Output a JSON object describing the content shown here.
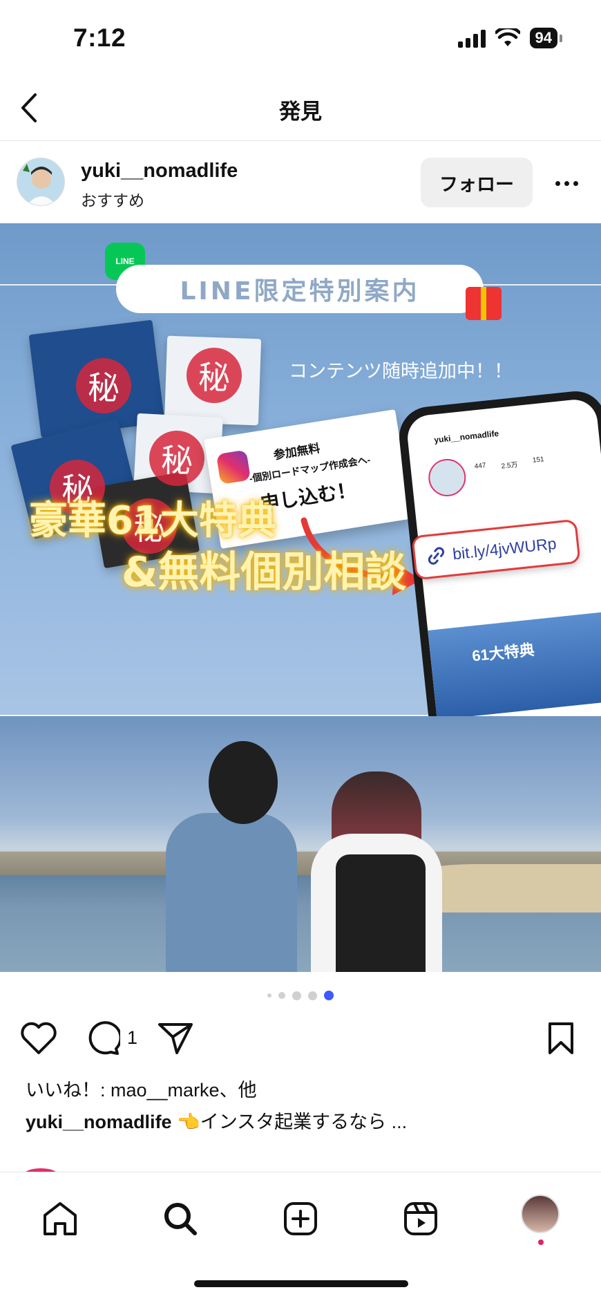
{
  "status_bar": {
    "time": "7:12",
    "battery": "94"
  },
  "nav": {
    "title": "発見"
  },
  "post": {
    "username": "yuki__nomadlife",
    "subtitle": "おすすめ",
    "follow_label": "フォロー",
    "image_text": {
      "line_badge": "LINE",
      "banner": "LINE限定特別案内",
      "contents": "コンテンツ随時追加中！！",
      "secret": "秘",
      "apply_free": "参加無料",
      "apply_sub": "-個別ロードマップ作成会へ-",
      "apply_cta": "申し込む！",
      "gold_line1": "豪華61大特典",
      "gold_line2": "&無料個別相談",
      "link": "bit.ly/4jvWURp",
      "phone_user": "yuki__nomadlife",
      "phone_banner": "61大特典"
    },
    "carousel": {
      "count": 5,
      "active": 5
    },
    "comment_count": "1",
    "likes_text": "いいね！: mao__marke、他",
    "caption_user": "yuki__nomadlife",
    "caption_text": " 👈インスタ起業するなら ..."
  },
  "tabs": [
    "home-icon",
    "search-icon",
    "create-icon",
    "reels-icon",
    "profile-avatar"
  ]
}
